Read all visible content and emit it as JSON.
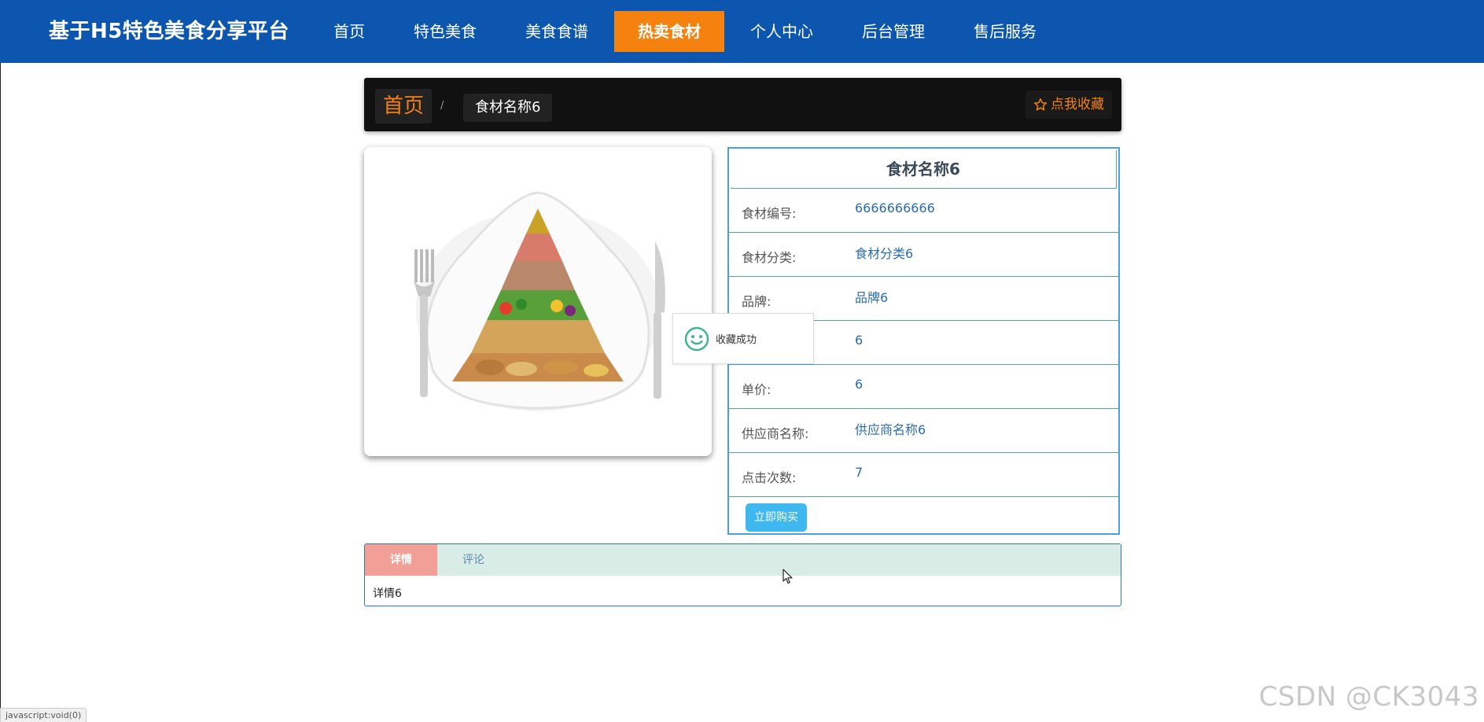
{
  "header": {
    "brand": "基于H5特色美食分享平台",
    "nav": [
      {
        "label": "首页"
      },
      {
        "label": "特色美食"
      },
      {
        "label": "美食食谱"
      },
      {
        "label": "热卖食材",
        "active": true
      },
      {
        "label": "个人中心"
      },
      {
        "label": "后台管理"
      },
      {
        "label": "售后服务"
      }
    ]
  },
  "breadcrumb": {
    "home": "首页",
    "separator": "/",
    "current": "食材名称6",
    "favorite_label": "点我收藏"
  },
  "product": {
    "image_icon": "food-pyramid-plate-image",
    "title": "食材名称6",
    "rows": [
      {
        "label": "食材编号:",
        "value": "6666666666"
      },
      {
        "label": "食材分类:",
        "value": "食材分类6"
      },
      {
        "label": "品牌:",
        "value": "品牌6"
      },
      {
        "label": "",
        "value": "6"
      },
      {
        "label": "单价:",
        "value": "6"
      },
      {
        "label": "供应商名称:",
        "value": "供应商名称6"
      },
      {
        "label": "点击次数:",
        "value": "7"
      }
    ],
    "buy_label": "立即购买"
  },
  "toast": {
    "icon": "smile-icon",
    "message": "收藏成功"
  },
  "tabs": {
    "items": [
      {
        "label": "详情",
        "active": true
      },
      {
        "label": "评论"
      }
    ],
    "content": "详情6"
  },
  "statusbar": {
    "text": "javascript:void(0)"
  },
  "watermark": "CSDN @CK3043",
  "colors": {
    "nav_bg": "#0c56b0",
    "nav_active": "#f5820f",
    "accent_orange": "#f5820f",
    "table_border": "#4aa0d8",
    "buy_button": "#3fb8f0",
    "tab_active": "#f2a097",
    "tab_head": "#d9ece6"
  }
}
